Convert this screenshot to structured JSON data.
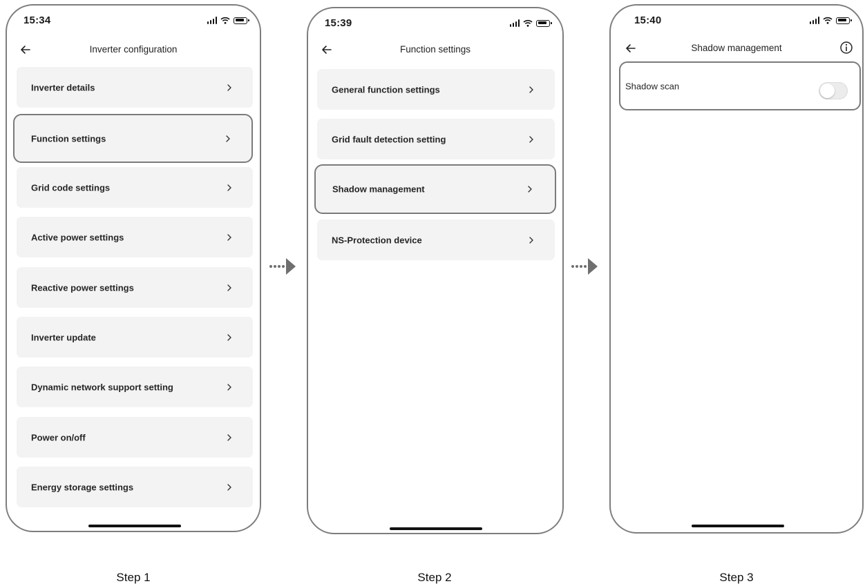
{
  "steps": [
    {
      "time": "15:34",
      "title": "Inverter configuration",
      "items": [
        {
          "label": "Inverter details"
        },
        {
          "label": "Function settings"
        },
        {
          "label": "Grid code settings"
        },
        {
          "label": "Active power settings"
        },
        {
          "label": "Reactive power settings"
        },
        {
          "label": "Inverter update"
        },
        {
          "label": "Dynamic network support setting"
        },
        {
          "label": "Power on/off"
        },
        {
          "label": "Energy storage settings"
        }
      ],
      "caption": "Step 1"
    },
    {
      "time": "15:39",
      "title": "Function settings",
      "items": [
        {
          "label": "General function settings"
        },
        {
          "label": "Grid fault detection setting"
        },
        {
          "label": "Shadow management"
        },
        {
          "label": "NS-Protection device"
        }
      ],
      "caption": "Step 2"
    },
    {
      "time": "15:40",
      "title": "Shadow management",
      "toggle_item": {
        "label": "Shadow scan",
        "enabled": false
      },
      "caption": "Step 3"
    }
  ],
  "highlight_color": "#7a7a7a",
  "icons": [
    "back-arrow-icon",
    "chevron-right-icon",
    "info-icon",
    "signal-icon",
    "wifi-icon",
    "battery-icon",
    "dotted-arrow-icon"
  ]
}
